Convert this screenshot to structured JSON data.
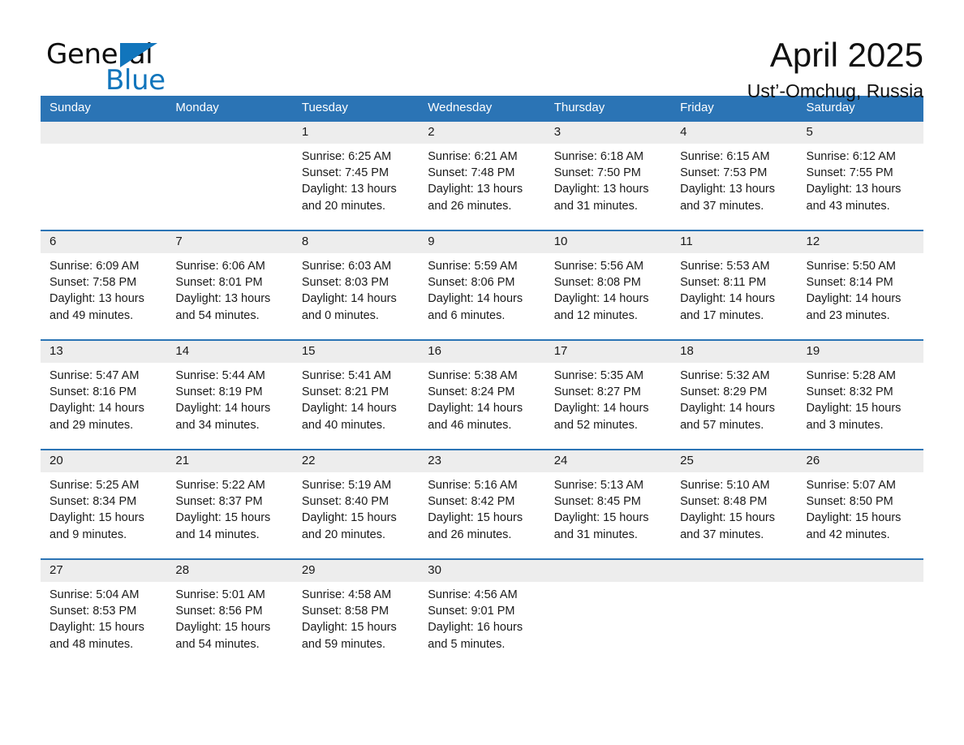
{
  "brand": {
    "name_top": "General",
    "name_bottom": "Blue",
    "flag_icon": "triangle-flag-icon",
    "accent_color": "#1175bc"
  },
  "header": {
    "month_title": "April 2025",
    "location": "Ust’-Omchug, Russia"
  },
  "theme": {
    "header_blue": "#2b74b5",
    "daynum_gray": "#ededed",
    "divider_blue": "#2b74b5",
    "text": "#1a1a1a"
  },
  "calendar": {
    "weekday_headers": [
      "Sunday",
      "Monday",
      "Tuesday",
      "Wednesday",
      "Thursday",
      "Friday",
      "Saturday"
    ],
    "weeks": [
      [
        {
          "day": "",
          "sunrise": "",
          "sunset": "",
          "daylight_1": "",
          "daylight_2": ""
        },
        {
          "day": "",
          "sunrise": "",
          "sunset": "",
          "daylight_1": "",
          "daylight_2": ""
        },
        {
          "day": "1",
          "sunrise": "Sunrise: 6:25 AM",
          "sunset": "Sunset: 7:45 PM",
          "daylight_1": "Daylight: 13 hours",
          "daylight_2": "and 20 minutes."
        },
        {
          "day": "2",
          "sunrise": "Sunrise: 6:21 AM",
          "sunset": "Sunset: 7:48 PM",
          "daylight_1": "Daylight: 13 hours",
          "daylight_2": "and 26 minutes."
        },
        {
          "day": "3",
          "sunrise": "Sunrise: 6:18 AM",
          "sunset": "Sunset: 7:50 PM",
          "daylight_1": "Daylight: 13 hours",
          "daylight_2": "and 31 minutes."
        },
        {
          "day": "4",
          "sunrise": "Sunrise: 6:15 AM",
          "sunset": "Sunset: 7:53 PM",
          "daylight_1": "Daylight: 13 hours",
          "daylight_2": "and 37 minutes."
        },
        {
          "day": "5",
          "sunrise": "Sunrise: 6:12 AM",
          "sunset": "Sunset: 7:55 PM",
          "daylight_1": "Daylight: 13 hours",
          "daylight_2": "and 43 minutes."
        }
      ],
      [
        {
          "day": "6",
          "sunrise": "Sunrise: 6:09 AM",
          "sunset": "Sunset: 7:58 PM",
          "daylight_1": "Daylight: 13 hours",
          "daylight_2": "and 49 minutes."
        },
        {
          "day": "7",
          "sunrise": "Sunrise: 6:06 AM",
          "sunset": "Sunset: 8:01 PM",
          "daylight_1": "Daylight: 13 hours",
          "daylight_2": "and 54 minutes."
        },
        {
          "day": "8",
          "sunrise": "Sunrise: 6:03 AM",
          "sunset": "Sunset: 8:03 PM",
          "daylight_1": "Daylight: 14 hours",
          "daylight_2": "and 0 minutes."
        },
        {
          "day": "9",
          "sunrise": "Sunrise: 5:59 AM",
          "sunset": "Sunset: 8:06 PM",
          "daylight_1": "Daylight: 14 hours",
          "daylight_2": "and 6 minutes."
        },
        {
          "day": "10",
          "sunrise": "Sunrise: 5:56 AM",
          "sunset": "Sunset: 8:08 PM",
          "daylight_1": "Daylight: 14 hours",
          "daylight_2": "and 12 minutes."
        },
        {
          "day": "11",
          "sunrise": "Sunrise: 5:53 AM",
          "sunset": "Sunset: 8:11 PM",
          "daylight_1": "Daylight: 14 hours",
          "daylight_2": "and 17 minutes."
        },
        {
          "day": "12",
          "sunrise": "Sunrise: 5:50 AM",
          "sunset": "Sunset: 8:14 PM",
          "daylight_1": "Daylight: 14 hours",
          "daylight_2": "and 23 minutes."
        }
      ],
      [
        {
          "day": "13",
          "sunrise": "Sunrise: 5:47 AM",
          "sunset": "Sunset: 8:16 PM",
          "daylight_1": "Daylight: 14 hours",
          "daylight_2": "and 29 minutes."
        },
        {
          "day": "14",
          "sunrise": "Sunrise: 5:44 AM",
          "sunset": "Sunset: 8:19 PM",
          "daylight_1": "Daylight: 14 hours",
          "daylight_2": "and 34 minutes."
        },
        {
          "day": "15",
          "sunrise": "Sunrise: 5:41 AM",
          "sunset": "Sunset: 8:21 PM",
          "daylight_1": "Daylight: 14 hours",
          "daylight_2": "and 40 minutes."
        },
        {
          "day": "16",
          "sunrise": "Sunrise: 5:38 AM",
          "sunset": "Sunset: 8:24 PM",
          "daylight_1": "Daylight: 14 hours",
          "daylight_2": "and 46 minutes."
        },
        {
          "day": "17",
          "sunrise": "Sunrise: 5:35 AM",
          "sunset": "Sunset: 8:27 PM",
          "daylight_1": "Daylight: 14 hours",
          "daylight_2": "and 52 minutes."
        },
        {
          "day": "18",
          "sunrise": "Sunrise: 5:32 AM",
          "sunset": "Sunset: 8:29 PM",
          "daylight_1": "Daylight: 14 hours",
          "daylight_2": "and 57 minutes."
        },
        {
          "day": "19",
          "sunrise": "Sunrise: 5:28 AM",
          "sunset": "Sunset: 8:32 PM",
          "daylight_1": "Daylight: 15 hours",
          "daylight_2": "and 3 minutes."
        }
      ],
      [
        {
          "day": "20",
          "sunrise": "Sunrise: 5:25 AM",
          "sunset": "Sunset: 8:34 PM",
          "daylight_1": "Daylight: 15 hours",
          "daylight_2": "and 9 minutes."
        },
        {
          "day": "21",
          "sunrise": "Sunrise: 5:22 AM",
          "sunset": "Sunset: 8:37 PM",
          "daylight_1": "Daylight: 15 hours",
          "daylight_2": "and 14 minutes."
        },
        {
          "day": "22",
          "sunrise": "Sunrise: 5:19 AM",
          "sunset": "Sunset: 8:40 PM",
          "daylight_1": "Daylight: 15 hours",
          "daylight_2": "and 20 minutes."
        },
        {
          "day": "23",
          "sunrise": "Sunrise: 5:16 AM",
          "sunset": "Sunset: 8:42 PM",
          "daylight_1": "Daylight: 15 hours",
          "daylight_2": "and 26 minutes."
        },
        {
          "day": "24",
          "sunrise": "Sunrise: 5:13 AM",
          "sunset": "Sunset: 8:45 PM",
          "daylight_1": "Daylight: 15 hours",
          "daylight_2": "and 31 minutes."
        },
        {
          "day": "25",
          "sunrise": "Sunrise: 5:10 AM",
          "sunset": "Sunset: 8:48 PM",
          "daylight_1": "Daylight: 15 hours",
          "daylight_2": "and 37 minutes."
        },
        {
          "day": "26",
          "sunrise": "Sunrise: 5:07 AM",
          "sunset": "Sunset: 8:50 PM",
          "daylight_1": "Daylight: 15 hours",
          "daylight_2": "and 42 minutes."
        }
      ],
      [
        {
          "day": "27",
          "sunrise": "Sunrise: 5:04 AM",
          "sunset": "Sunset: 8:53 PM",
          "daylight_1": "Daylight: 15 hours",
          "daylight_2": "and 48 minutes."
        },
        {
          "day": "28",
          "sunrise": "Sunrise: 5:01 AM",
          "sunset": "Sunset: 8:56 PM",
          "daylight_1": "Daylight: 15 hours",
          "daylight_2": "and 54 minutes."
        },
        {
          "day": "29",
          "sunrise": "Sunrise: 4:58 AM",
          "sunset": "Sunset: 8:58 PM",
          "daylight_1": "Daylight: 15 hours",
          "daylight_2": "and 59 minutes."
        },
        {
          "day": "30",
          "sunrise": "Sunrise: 4:56 AM",
          "sunset": "Sunset: 9:01 PM",
          "daylight_1": "Daylight: 16 hours",
          "daylight_2": "and 5 minutes."
        },
        {
          "day": "",
          "sunrise": "",
          "sunset": "",
          "daylight_1": "",
          "daylight_2": ""
        },
        {
          "day": "",
          "sunrise": "",
          "sunset": "",
          "daylight_1": "",
          "daylight_2": ""
        },
        {
          "day": "",
          "sunrise": "",
          "sunset": "",
          "daylight_1": "",
          "daylight_2": ""
        }
      ]
    ]
  }
}
